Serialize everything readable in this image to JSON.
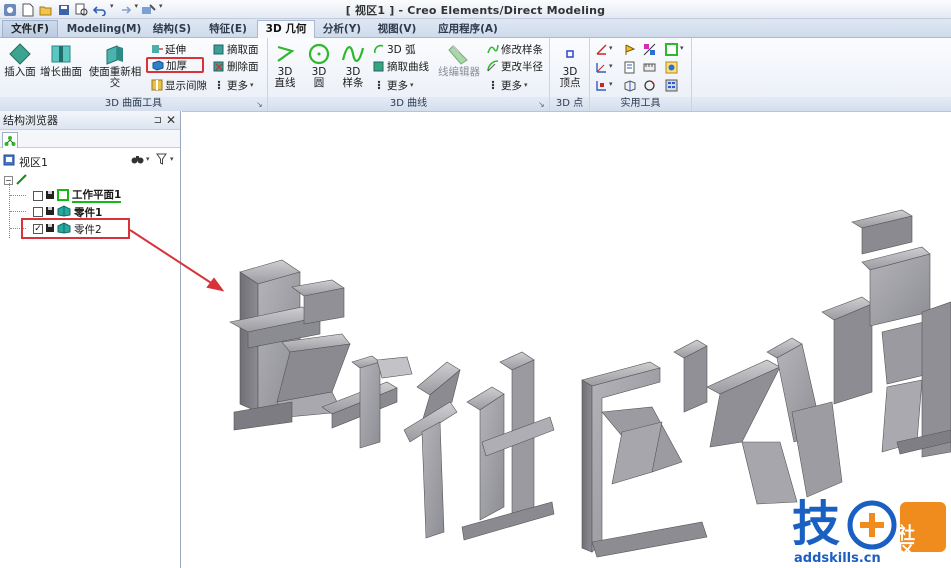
{
  "window": {
    "title": "[ 视区1 ] - Creo Elements/Direct Modeling"
  },
  "qat": {
    "undo_dropdown": "▾",
    "redo_dropdown": "▾",
    "customize": "▾"
  },
  "tabs": [
    {
      "label": "文件(F)"
    },
    {
      "label": "Modeling(M)"
    },
    {
      "label": "结构(S)"
    },
    {
      "label": "特征(E)"
    },
    {
      "label": "3D 几何"
    },
    {
      "label": "分析(Y)"
    },
    {
      "label": "视图(V)"
    },
    {
      "label": "应用程序(A)"
    }
  ],
  "ribbon": {
    "surface_tools": {
      "label": "3D 曲面工具",
      "insert_face": "插入面",
      "grow_surface": "增长曲面",
      "reintersect": "使面重新相交",
      "extend": "延伸",
      "thicken": "加厚",
      "show_gap": "显示间隙",
      "extract_face": "摘取面",
      "delete_face": "删除面",
      "more": "更多",
      "dropdown": "▾",
      "launcher": "↘"
    },
    "curves": {
      "label": "3D 曲线",
      "line": "3D\n直线",
      "circle": "3D\n圆",
      "spline": "3D\n样条",
      "arc": "3D 弧",
      "extract_curve": "摘取曲线",
      "more": "更多",
      "wire_editor": "线编辑器",
      "modify_spline": "修改样条",
      "change_radius": "更改半径",
      "more2": "更多",
      "dropdown": "▾",
      "launcher": "↘"
    },
    "points": {
      "label": "3D 点",
      "vertex": "3D\n顶点"
    },
    "utility": {
      "label": "实用工具",
      "dropdown": "▾"
    }
  },
  "browser": {
    "title": "结构浏览器",
    "pin": "⊐",
    "close": "✕",
    "view": "视区1",
    "view_dropdown": "▾",
    "filter_dropdown": "▾",
    "items": [
      {
        "label": "工作平面1",
        "checked": false
      },
      {
        "label": "零件1",
        "checked": false
      },
      {
        "label": "零件2",
        "checked": true
      }
    ],
    "checkmark": "✓"
  },
  "watermark": {
    "char": "技",
    "badge": "社区",
    "url": "addskills.cn"
  },
  "colors": {
    "annotation_red": "#d9333a",
    "part_gray": "#8a8a8a",
    "green_plane": "#15b915",
    "watermark_blue": "#1a5fc2",
    "watermark_orange": "#f08c1e"
  }
}
